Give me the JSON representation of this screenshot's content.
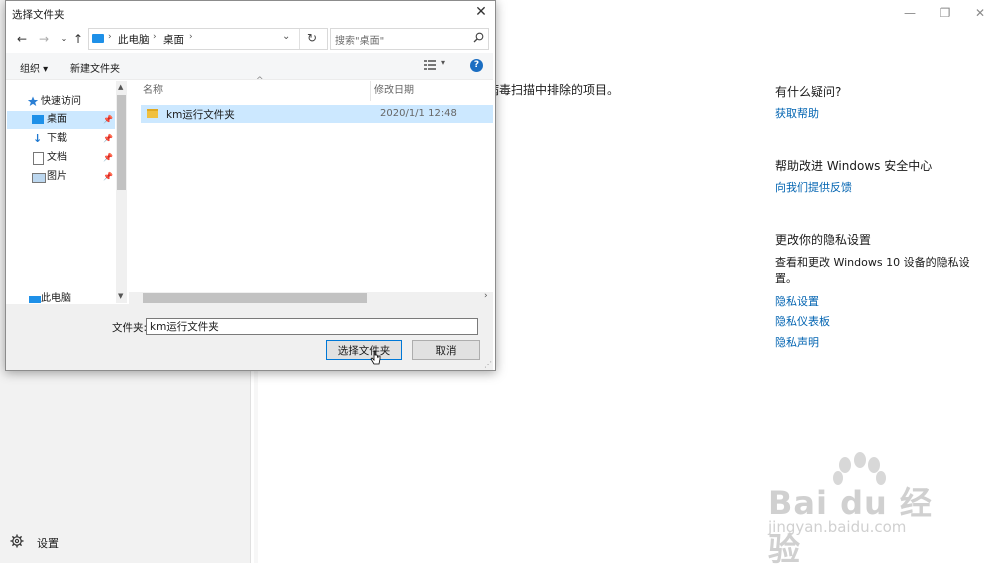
{
  "background_app": {
    "sidebar_settings_label": "设置",
    "main_text_fragment": "病毒扫描中排除的项目。",
    "window_controls": [
      "—",
      "❐",
      "✕"
    ],
    "right_panel": {
      "help_heading": "有什么疑问?",
      "help_link": "获取帮助",
      "improve_heading": "帮助改进 Windows 安全中心",
      "improve_link": "向我们提供反馈",
      "privacy_heading": "更改你的隐私设置",
      "privacy_text": "查看和更改 Windows 10 设备的隐私设置。",
      "privacy_links": [
        "隐私设置",
        "隐私仪表板",
        "隐私声明"
      ]
    }
  },
  "dialog": {
    "title": "选择文件夹",
    "close_glyph": "✕",
    "address": {
      "segments": [
        "此电脑",
        "桌面"
      ]
    },
    "search": {
      "placeholder": "搜索\"桌面\""
    },
    "toolbar": {
      "organize": "组织 ▾",
      "new_folder": "新建文件夹",
      "help_glyph": "?"
    },
    "nav": {
      "items": [
        {
          "label": "快速访问",
          "pinned": false
        },
        {
          "label": "桌面",
          "pinned": true
        },
        {
          "label": "下载",
          "pinned": true
        },
        {
          "label": "文档",
          "pinned": true
        },
        {
          "label": "图片",
          "pinned": true
        },
        {
          "label": "此电脑",
          "pinned": false
        }
      ]
    },
    "columns": {
      "name": "名称",
      "modified": "修改日期"
    },
    "rows": [
      {
        "name": "km运行文件夹",
        "modified": "2020/1/1 12:48"
      }
    ],
    "filename_label": "文件夹:",
    "filename_value": "km运行文件夹",
    "select_button": "选择文件夹",
    "cancel_button": "取消"
  },
  "watermark": {
    "brand": "Bai du 经验",
    "url": "jingyan.baidu.com"
  },
  "colors": {
    "accent": "#0078d7",
    "link": "#0063b1",
    "selection": "#cce8ff"
  }
}
